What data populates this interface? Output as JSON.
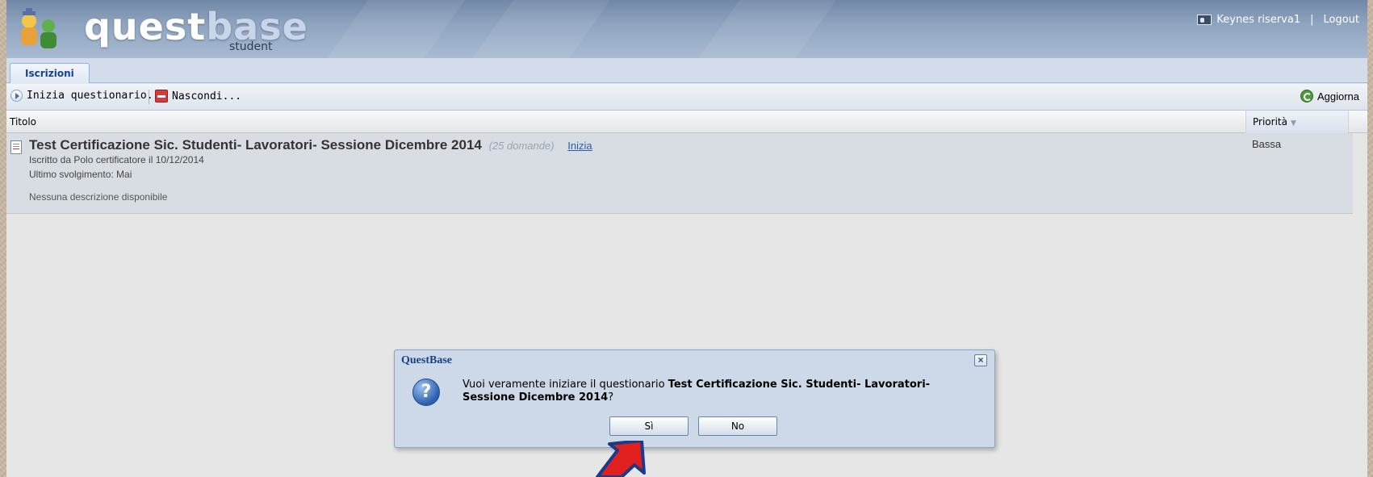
{
  "header": {
    "brand_bold": "quest",
    "brand_light": "base",
    "brand_sub": "student",
    "user_name": "Keynes riserva1",
    "separator": "|",
    "logout": "Logout"
  },
  "tabs": [
    {
      "label": "Iscrizioni"
    }
  ],
  "toolbar": {
    "start_label": "Inizia questionario...",
    "hide_label": "Nascondi...",
    "refresh_label": "Aggiorna"
  },
  "grid": {
    "columns": [
      "Titolo",
      "Priorità"
    ],
    "sort_arrow": "▼",
    "rows": [
      {
        "title": "Test Certificazione Sic. Studenti- Lavoratori- Sessione Dicembre 2014",
        "question_count": "(25 domande)",
        "start_link": "Inizia",
        "enrolled": "Iscritto da Polo certificatore il 10/12/2014",
        "last_run": "Ultimo svolgimento: Mai",
        "description": "Nessuna descrizione disponibile",
        "priority": "Bassa"
      }
    ]
  },
  "dialog": {
    "title": "QuestBase",
    "close": "×",
    "icon_glyph": "?",
    "message_prefix": "Vuoi veramente iniziare il questionario ",
    "message_bold": "Test Certificazione Sic. Studenti- Lavoratori- Sessione Dicembre 2014",
    "message_suffix": "?",
    "yes_label": "Sì",
    "no_label": "No"
  },
  "colors": {
    "accent": "#15428b",
    "arrow": "#e0201f",
    "arrow_outline": "#1a3a8c"
  }
}
